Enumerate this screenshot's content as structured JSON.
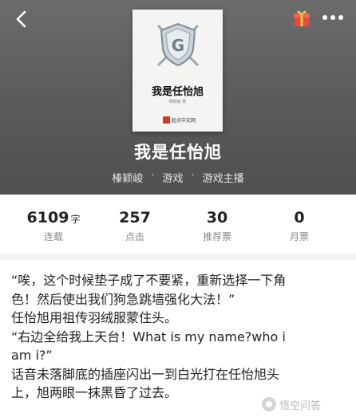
{
  "header": {
    "book_title": "我是任怡旭",
    "author": "榛颖峻",
    "genre": "游戏",
    "subgenre": "游戏主播",
    "separator": "·"
  },
  "cover": {
    "title": "我是任怡旭",
    "author": "榛颖峻 著",
    "publisher": "起点中文网",
    "emblem_letter": "G"
  },
  "stats": [
    {
      "value": "6109",
      "unit": "字",
      "label": "连载"
    },
    {
      "value": "257",
      "unit": "",
      "label": "点击"
    },
    {
      "value": "30",
      "unit": "",
      "label": "推荐票"
    },
    {
      "value": "0",
      "unit": "",
      "label": "月票"
    }
  ],
  "content": {
    "lines": [
      "“唉，这个时候垫子成了不要紧，重新选择一下角",
      "色！然后使出我们狗急跳墙强化大法！”",
      "任怡旭用祖传羽绒服蒙住头。",
      "“右边全给我上天台！What is my name?who i",
      "am i?”",
      "话音未落脚底的插座闪出一到白光打在任怡旭头",
      "上，旭两眼一抹黑昏了过去。"
    ]
  },
  "watermark": "悟空问答",
  "icons": {
    "back": "back-arrow-icon",
    "gift": "gift-icon",
    "more": "more-dots-icon"
  },
  "colors": {
    "header_bg": "#5d5d5d",
    "gift_red": "#e84b3c",
    "gift_gold": "#f5c842"
  }
}
